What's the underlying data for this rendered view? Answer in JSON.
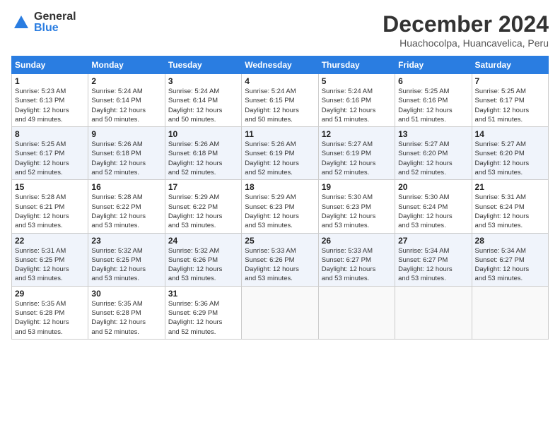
{
  "logo": {
    "general": "General",
    "blue": "Blue"
  },
  "header": {
    "title": "December 2024",
    "subtitle": "Huachocolpa, Huancavelica, Peru"
  },
  "columns": [
    "Sunday",
    "Monday",
    "Tuesday",
    "Wednesday",
    "Thursday",
    "Friday",
    "Saturday"
  ],
  "weeks": [
    [
      {
        "day": "1",
        "info": "Sunrise: 5:23 AM\nSunset: 6:13 PM\nDaylight: 12 hours\nand 49 minutes."
      },
      {
        "day": "2",
        "info": "Sunrise: 5:24 AM\nSunset: 6:14 PM\nDaylight: 12 hours\nand 50 minutes."
      },
      {
        "day": "3",
        "info": "Sunrise: 5:24 AM\nSunset: 6:14 PM\nDaylight: 12 hours\nand 50 minutes."
      },
      {
        "day": "4",
        "info": "Sunrise: 5:24 AM\nSunset: 6:15 PM\nDaylight: 12 hours\nand 50 minutes."
      },
      {
        "day": "5",
        "info": "Sunrise: 5:24 AM\nSunset: 6:16 PM\nDaylight: 12 hours\nand 51 minutes."
      },
      {
        "day": "6",
        "info": "Sunrise: 5:25 AM\nSunset: 6:16 PM\nDaylight: 12 hours\nand 51 minutes."
      },
      {
        "day": "7",
        "info": "Sunrise: 5:25 AM\nSunset: 6:17 PM\nDaylight: 12 hours\nand 51 minutes."
      }
    ],
    [
      {
        "day": "8",
        "info": "Sunrise: 5:25 AM\nSunset: 6:17 PM\nDaylight: 12 hours\nand 52 minutes."
      },
      {
        "day": "9",
        "info": "Sunrise: 5:26 AM\nSunset: 6:18 PM\nDaylight: 12 hours\nand 52 minutes."
      },
      {
        "day": "10",
        "info": "Sunrise: 5:26 AM\nSunset: 6:18 PM\nDaylight: 12 hours\nand 52 minutes."
      },
      {
        "day": "11",
        "info": "Sunrise: 5:26 AM\nSunset: 6:19 PM\nDaylight: 12 hours\nand 52 minutes."
      },
      {
        "day": "12",
        "info": "Sunrise: 5:27 AM\nSunset: 6:19 PM\nDaylight: 12 hours\nand 52 minutes."
      },
      {
        "day": "13",
        "info": "Sunrise: 5:27 AM\nSunset: 6:20 PM\nDaylight: 12 hours\nand 52 minutes."
      },
      {
        "day": "14",
        "info": "Sunrise: 5:27 AM\nSunset: 6:20 PM\nDaylight: 12 hours\nand 53 minutes."
      }
    ],
    [
      {
        "day": "15",
        "info": "Sunrise: 5:28 AM\nSunset: 6:21 PM\nDaylight: 12 hours\nand 53 minutes."
      },
      {
        "day": "16",
        "info": "Sunrise: 5:28 AM\nSunset: 6:22 PM\nDaylight: 12 hours\nand 53 minutes."
      },
      {
        "day": "17",
        "info": "Sunrise: 5:29 AM\nSunset: 6:22 PM\nDaylight: 12 hours\nand 53 minutes."
      },
      {
        "day": "18",
        "info": "Sunrise: 5:29 AM\nSunset: 6:23 PM\nDaylight: 12 hours\nand 53 minutes."
      },
      {
        "day": "19",
        "info": "Sunrise: 5:30 AM\nSunset: 6:23 PM\nDaylight: 12 hours\nand 53 minutes."
      },
      {
        "day": "20",
        "info": "Sunrise: 5:30 AM\nSunset: 6:24 PM\nDaylight: 12 hours\nand 53 minutes."
      },
      {
        "day": "21",
        "info": "Sunrise: 5:31 AM\nSunset: 6:24 PM\nDaylight: 12 hours\nand 53 minutes."
      }
    ],
    [
      {
        "day": "22",
        "info": "Sunrise: 5:31 AM\nSunset: 6:25 PM\nDaylight: 12 hours\nand 53 minutes."
      },
      {
        "day": "23",
        "info": "Sunrise: 5:32 AM\nSunset: 6:25 PM\nDaylight: 12 hours\nand 53 minutes."
      },
      {
        "day": "24",
        "info": "Sunrise: 5:32 AM\nSunset: 6:26 PM\nDaylight: 12 hours\nand 53 minutes."
      },
      {
        "day": "25",
        "info": "Sunrise: 5:33 AM\nSunset: 6:26 PM\nDaylight: 12 hours\nand 53 minutes."
      },
      {
        "day": "26",
        "info": "Sunrise: 5:33 AM\nSunset: 6:27 PM\nDaylight: 12 hours\nand 53 minutes."
      },
      {
        "day": "27",
        "info": "Sunrise: 5:34 AM\nSunset: 6:27 PM\nDaylight: 12 hours\nand 53 minutes."
      },
      {
        "day": "28",
        "info": "Sunrise: 5:34 AM\nSunset: 6:27 PM\nDaylight: 12 hours\nand 53 minutes."
      }
    ],
    [
      {
        "day": "29",
        "info": "Sunrise: 5:35 AM\nSunset: 6:28 PM\nDaylight: 12 hours\nand 53 minutes."
      },
      {
        "day": "30",
        "info": "Sunrise: 5:35 AM\nSunset: 6:28 PM\nDaylight: 12 hours\nand 52 minutes."
      },
      {
        "day": "31",
        "info": "Sunrise: 5:36 AM\nSunset: 6:29 PM\nDaylight: 12 hours\nand 52 minutes."
      },
      {
        "day": "",
        "info": ""
      },
      {
        "day": "",
        "info": ""
      },
      {
        "day": "",
        "info": ""
      },
      {
        "day": "",
        "info": ""
      }
    ]
  ]
}
